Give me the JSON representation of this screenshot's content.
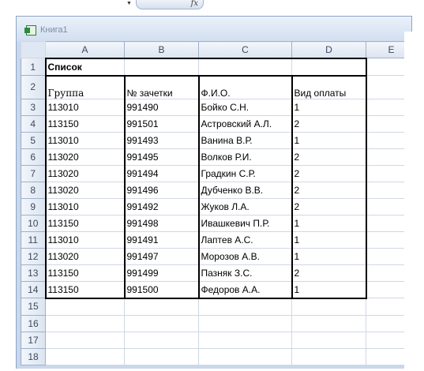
{
  "formula_bar": {
    "fx_label": "fx"
  },
  "window": {
    "title": "Книга1"
  },
  "columns": [
    "A",
    "B",
    "C",
    "D",
    "E"
  ],
  "rows": [
    {
      "num": "1",
      "cells": [
        "Список",
        "",
        "",
        "",
        ""
      ]
    },
    {
      "num": "2",
      "cells": [
        "Группа",
        "№ зачетки",
        "Ф.И.О.",
        "Вид оплаты",
        ""
      ]
    },
    {
      "num": "3",
      "cells": [
        "113010",
        "991490",
        "Бойко С.Н.",
        "1",
        ""
      ]
    },
    {
      "num": "4",
      "cells": [
        "113150",
        "991501",
        "Астровский А.Л.",
        "2",
        ""
      ]
    },
    {
      "num": "5",
      "cells": [
        "113010",
        "991493",
        "Ванина В.Р.",
        "1",
        ""
      ]
    },
    {
      "num": "6",
      "cells": [
        "113020",
        "991495",
        "Волков Р.И.",
        "2",
        ""
      ]
    },
    {
      "num": "7",
      "cells": [
        "113020",
        "991494",
        "Градкин С.Р.",
        "2",
        ""
      ]
    },
    {
      "num": "8",
      "cells": [
        "113020",
        "991496",
        "Дубченко В.В.",
        "2",
        ""
      ]
    },
    {
      "num": "9",
      "cells": [
        "113010",
        "991492",
        "Жуков Л.А.",
        "2",
        ""
      ]
    },
    {
      "num": "10",
      "cells": [
        "113150",
        "991498",
        "Ивашкевич П.Р.",
        "1",
        ""
      ]
    },
    {
      "num": "11",
      "cells": [
        "113010",
        "991491",
        "Лаптев А.С.",
        "1",
        ""
      ]
    },
    {
      "num": "12",
      "cells": [
        "113020",
        "991497",
        "Морозов А.В.",
        "1",
        ""
      ]
    },
    {
      "num": "13",
      "cells": [
        "113150",
        "991499",
        "Пазняк З.С.",
        "2",
        ""
      ]
    },
    {
      "num": "14",
      "cells": [
        "113150",
        "991500",
        "Федоров А.А.",
        "1",
        ""
      ]
    },
    {
      "num": "15",
      "cells": [
        "",
        "",
        "",
        "",
        ""
      ]
    },
    {
      "num": "16",
      "cells": [
        "",
        "",
        "",
        "",
        ""
      ]
    },
    {
      "num": "17",
      "cells": [
        "",
        "",
        "",
        "",
        ""
      ]
    },
    {
      "num": "18",
      "cells": [
        "",
        "",
        "",
        "",
        ""
      ]
    }
  ]
}
